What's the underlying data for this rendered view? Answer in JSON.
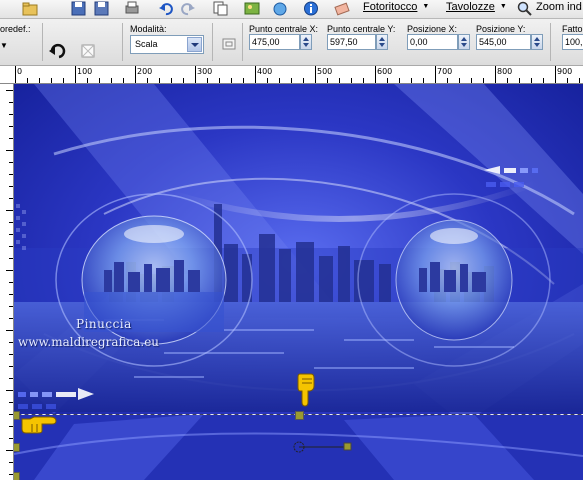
{
  "menubar": {
    "items": [
      {
        "label": "Fotoritocco"
      },
      {
        "label": "Tavolozze"
      },
      {
        "label": "Zoom ind"
      }
    ]
  },
  "tool_options": {
    "preset_label": "oredef.:",
    "mode_label": "Modalità:",
    "mode_value": "Scala",
    "center_x_label": "Punto centrale X:",
    "center_x_value": "475,00",
    "center_y_label": "Punto centrale Y:",
    "center_y_value": "597,50",
    "pos_x_label": "Posizione X:",
    "pos_x_value": "0,00",
    "pos_y_label": "Posizione Y:",
    "pos_y_value": "545,00",
    "factor_label": "Fatto",
    "factor_value": "100,"
  },
  "ruler": {
    "top": [
      "0",
      "100",
      "200",
      "300",
      "400",
      "500",
      "600",
      "700",
      "800",
      "900"
    ]
  },
  "canvas": {
    "watermark_line1": "Pinuccia",
    "watermark_line2": "www.maldiregrafica.eu"
  },
  "colors": {
    "canvas_blue": "#2a34b8",
    "selection_handle": "#9a9a30",
    "pointer_yellow": "#f5c400"
  }
}
